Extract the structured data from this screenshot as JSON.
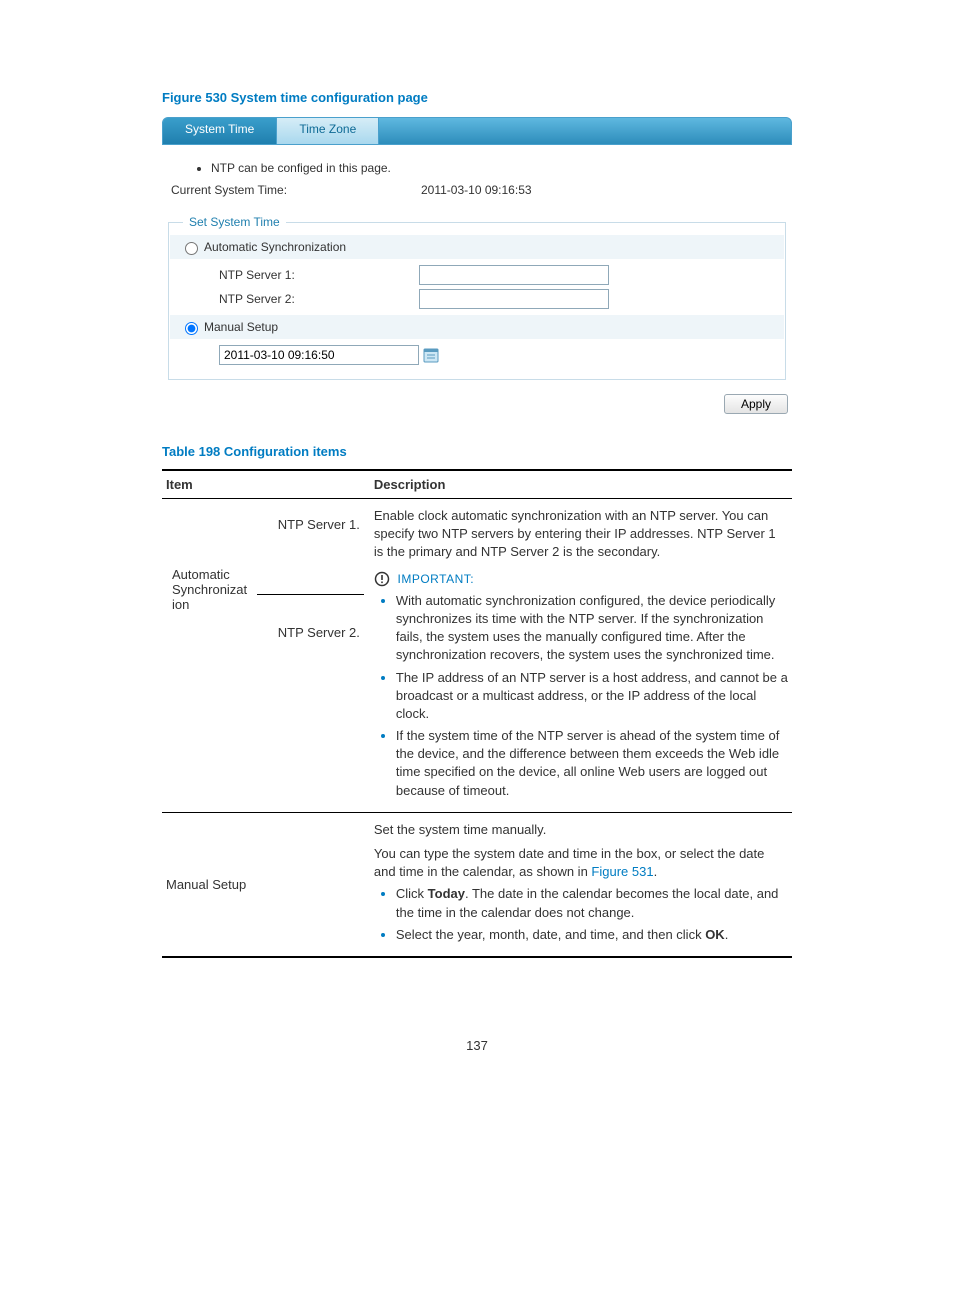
{
  "figure_caption": "Figure 530 System time configuration page",
  "tabs": {
    "system_time": "System Time",
    "time_zone": "Time Zone"
  },
  "note": "NTP can be configed in this page.",
  "current_time_label": "Current System Time:",
  "current_time_value": "2011-03-10 09:16:53",
  "fieldset_legend": "Set System Time",
  "auto_sync_label": "Automatic Synchronization",
  "ntp1_label": "NTP Server 1:",
  "ntp1_value": "",
  "ntp2_label": "NTP Server 2:",
  "ntp2_value": "",
  "manual_setup_label": "Manual Setup",
  "manual_datetime_value": "2011-03-10 09:16:50",
  "apply_label": "Apply",
  "table_caption": "Table 198 Configuration items",
  "table": {
    "header_item": "Item",
    "header_desc": "Description",
    "row1": {
      "item_main": "Automatic Synchronizat ion",
      "sub1": "NTP Server 1.",
      "sub2": "NTP Server 2.",
      "desc_intro": "Enable clock automatic synchronization with an NTP server. You can specify two NTP servers by entering their IP addresses. NTP Server 1 is the primary and NTP Server 2 is the secondary.",
      "important_label": "IMPORTANT:",
      "b1": "With automatic synchronization configured, the device periodically synchronizes its time with the NTP server. If the synchronization fails, the system uses the manually configured time. After the synchronization recovers, the system uses the synchronized time.",
      "b2": "The IP address of an NTP server is a host address, and cannot be a broadcast or a multicast address, or the IP address of the local clock.",
      "b3": "If the system time of the NTP server is ahead of the system time of the device, and the difference between them exceeds the Web idle time specified on the device, all online Web users are logged out because of timeout."
    },
    "row2": {
      "item": "Manual Setup",
      "d1": "Set the system time manually.",
      "d2_pre": "You can type the system date and time in the box, or select the date and time in the calendar, as shown in ",
      "d2_link": "Figure 531",
      "d2_post": ".",
      "li1_pre": "Click ",
      "li1_bold": "Today",
      "li1_post": ". The date in the calendar becomes the local date, and the time in the calendar does not change.",
      "li2_pre": "Select the year, month, date, and time, and then click ",
      "li2_bold": "OK",
      "li2_post": "."
    }
  },
  "page_number": "137"
}
